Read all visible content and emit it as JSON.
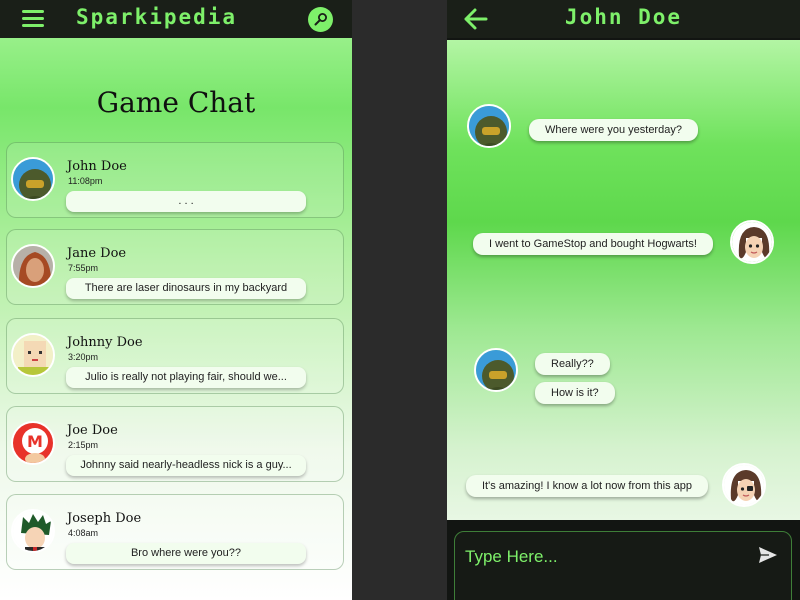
{
  "left_screen": {
    "app_title": "Sparkipedia",
    "page_title": "Game Chat",
    "chats": [
      {
        "name": "John Doe",
        "time": "11:08pm",
        "preview": ". . .",
        "avatar": "doom-slayer-avatar"
      },
      {
        "name": "Jane Doe",
        "time": "7:55pm",
        "preview": "There are laser dinosaurs in my backyard",
        "avatar": "aloy-avatar"
      },
      {
        "name": "Johnny Doe",
        "time": "3:20pm",
        "preview": "Julio is really not playing fair, should we...",
        "avatar": "blocky-character-avatar"
      },
      {
        "name": "Joe Doe",
        "time": "2:15pm",
        "preview": "Johnny said nearly-headless nick is a guy...",
        "avatar": "mario-avatar"
      },
      {
        "name": "Joseph Doe",
        "time": "4:08am",
        "preview": "Bro where were you??",
        "avatar": "anime-hero-avatar"
      }
    ]
  },
  "right_screen": {
    "contact_name": "John Doe",
    "messages": [
      {
        "from": "them",
        "text": "Where were you yesterday?"
      },
      {
        "from": "me",
        "text": "I went to GameStop and bought Hogwarts!"
      },
      {
        "from": "them",
        "text": "Really??"
      },
      {
        "from": "them",
        "text": "How is it?"
      },
      {
        "from": "me",
        "text": "It's amazing! I know a lot now from this app"
      }
    ],
    "composer": {
      "placeholder": "Type Here..."
    }
  },
  "colors": {
    "accent": "#7ef06a",
    "topbar": "#1a1f18",
    "bubble": "#f2fdee",
    "background": "#2b2b2b"
  },
  "icons": [
    "menu-icon",
    "search-icon",
    "back-arrow-icon",
    "send-icon"
  ]
}
